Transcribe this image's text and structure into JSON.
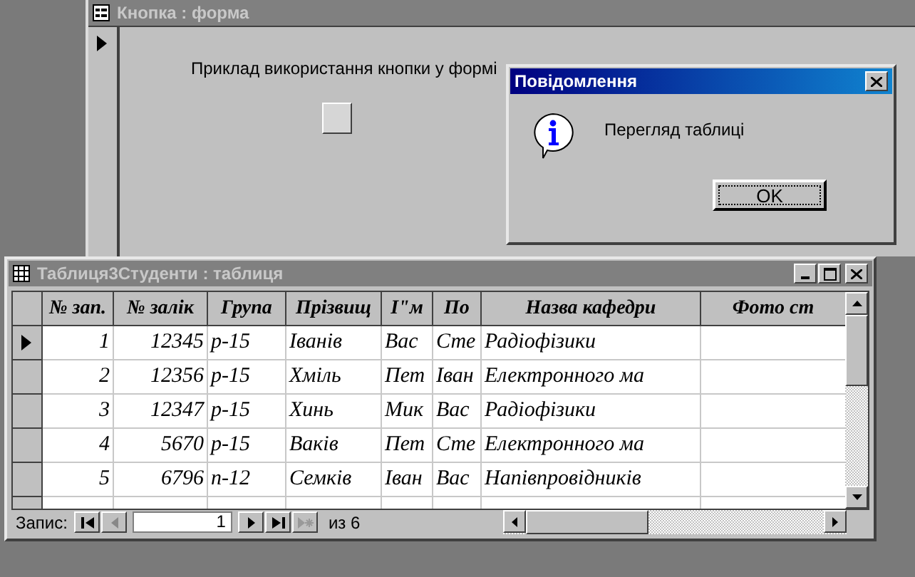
{
  "form_window": {
    "title": "Кнопка : форма",
    "caption": "Приклад використання кнопки у формі",
    "record_selected": true
  },
  "message_dialog": {
    "title": "Повідомлення",
    "message": "Перегляд таблиці",
    "buttons": [
      "OK"
    ]
  },
  "table_window": {
    "title": "Таблиця3Студенти : таблиця",
    "columns": [
      "№ зап.",
      "№ залік",
      "Група",
      "Прізвищ",
      "І\"м",
      "По",
      "Назва кафедри",
      "Фото ст"
    ],
    "rows": [
      {
        "selected": true,
        "cells": [
          "1",
          "12345",
          "р-15",
          "Іванів",
          "Вас",
          "Сте",
          "Радіофізики"
        ]
      },
      {
        "selected": false,
        "cells": [
          "2",
          "12356",
          "р-15",
          "Хміль",
          "Пет",
          "Іван",
          "Електронного ма"
        ]
      },
      {
        "selected": false,
        "cells": [
          "3",
          "12347",
          "р-15",
          "Хинь",
          "Мик",
          "Вас",
          "Радіофізики"
        ]
      },
      {
        "selected": false,
        "cells": [
          "4",
          "5670",
          "р-15",
          "Ваків",
          "Пет",
          "Сте",
          "Електронного ма"
        ]
      },
      {
        "selected": false,
        "cells": [
          "5",
          "6796",
          "п-12",
          "Семків",
          "Іван",
          "Вас",
          "Напівпровідників"
        ]
      }
    ],
    "navigation": {
      "label": "Запис:",
      "current": "1",
      "total": "из 6"
    }
  }
}
